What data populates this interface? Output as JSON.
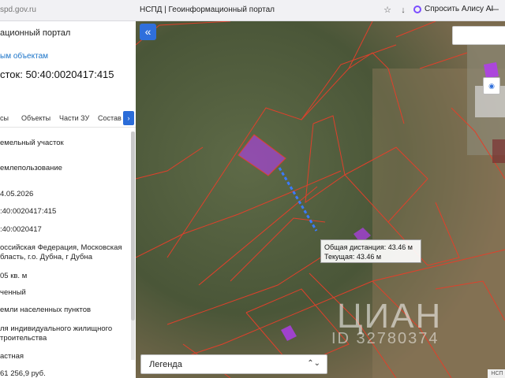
{
  "browser": {
    "url": "spd.gov.ru",
    "tab_title": "НСПД | Геоинформационный портал",
    "bookmark_icon": "bookmark-icon",
    "alisa_label": "Спросить Алису AI",
    "minimize_label": "—"
  },
  "panel": {
    "title": "ационный портал",
    "link": "ым объектам",
    "cadastral": "сток: 50:40:0020417:415",
    "tabs": [
      "сы",
      "Объекты",
      "Части ЗУ",
      "Состав"
    ],
    "tab_next": "›",
    "values": [
      "емельный участок",
      "емлепользование",
      "4.05.2026",
      ":40:0020417:415",
      ":40:0020417",
      "оссийская Федерация, Московская",
      "бласть, г.о. Дубна, г Дубна",
      "05 кв. м",
      "ченный",
      "емли населенных пунктов",
      "ля индивидуального жилищного",
      "троительства",
      "астная",
      "61 256,9 руб."
    ]
  },
  "map": {
    "collapse_label": "«",
    "tooltip_line1": "Общая дистанция: 43.46 м",
    "tooltip_line2": "Текущая: 43.46 м",
    "legend_label": "Легенда",
    "legend_chevron": "⌃⌄",
    "watermark_brand": "ЦИАН",
    "watermark_id": "ID 32780374",
    "corner_badge": "НСП",
    "tool_icon": "locate-icon",
    "colors": {
      "parcel_border": "#e0402b",
      "highlight": "#b23cf0",
      "measure_line": "#3a7bff"
    }
  }
}
